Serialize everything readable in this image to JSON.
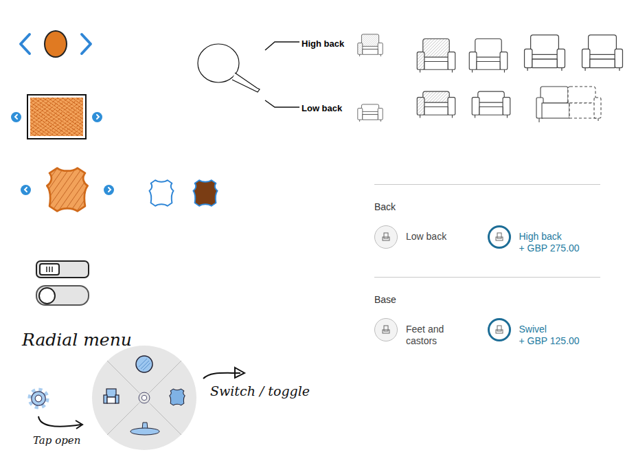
{
  "color_carousel": {
    "color": "#e07a22"
  },
  "fabric": {
    "color": "#f2a25a"
  },
  "leather": {
    "color": "#f2a25a",
    "choices": [
      {
        "color": "#ffffff"
      },
      {
        "color": "#7a3d14"
      }
    ]
  },
  "toggles": [
    {
      "kind": "grip",
      "on": false
    },
    {
      "kind": "round",
      "on": false
    }
  ],
  "notes": {
    "radial_title": "Radial menu",
    "tap_note": "Tap open",
    "switch_note": "Switch / toggle"
  },
  "radial_menu": {
    "items": [
      {
        "kind": "color"
      },
      {
        "kind": "leather"
      },
      {
        "kind": "base"
      },
      {
        "kind": "chair"
      }
    ]
  },
  "diagram": {
    "labels": [
      "High back",
      "Low back"
    ]
  },
  "options": [
    {
      "title": "Back",
      "choices": [
        {
          "label": "Low back",
          "price": "",
          "selected": false
        },
        {
          "label": "High back",
          "price": "+ GBP 275.00",
          "selected": true
        }
      ]
    },
    {
      "title": "Base",
      "choices": [
        {
          "label": "Feet and castors",
          "price": "",
          "selected": false
        },
        {
          "label": "Swivel",
          "price": "+ GBP 125.00",
          "selected": true
        }
      ]
    }
  ]
}
